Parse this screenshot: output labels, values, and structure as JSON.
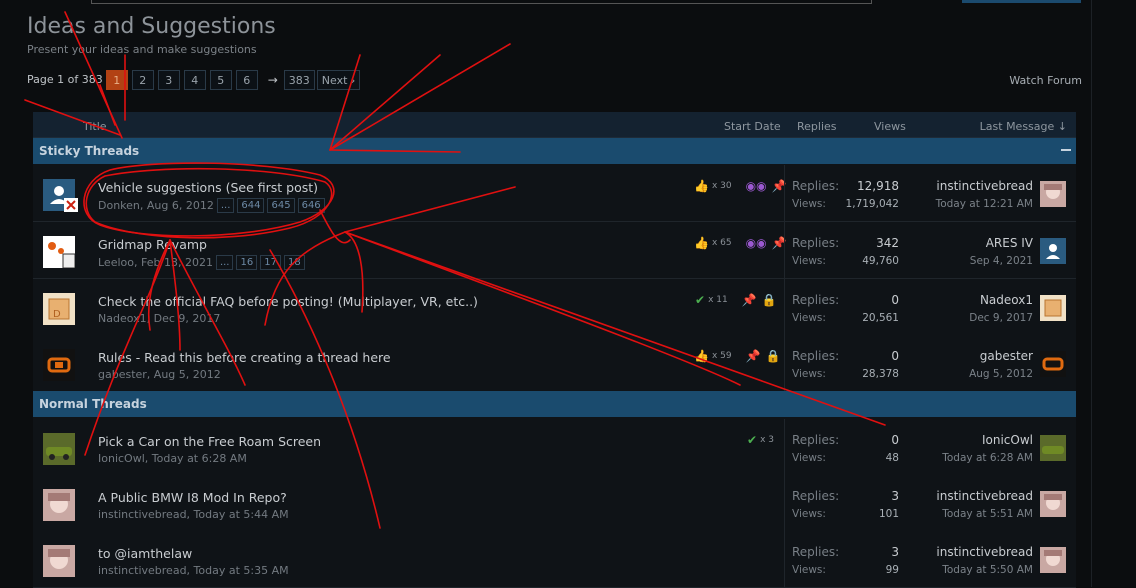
{
  "header": {
    "title": "Ideas and Suggestions",
    "subtitle": "Present your ideas and make suggestions"
  },
  "pagenav": {
    "info": "Page 1 of 383",
    "pages": [
      "1",
      "2",
      "3",
      "4",
      "5",
      "6"
    ],
    "current": "1",
    "arrow": "→",
    "last": "383",
    "next": "Next ›"
  },
  "watch_forum": "Watch Forum",
  "columns": {
    "title": "Title",
    "start_date": "Start Date",
    "replies": "Replies",
    "views": "Views",
    "last_message": "Last Message ↓"
  },
  "sections": {
    "sticky": "Sticky Threads",
    "normal": "Normal Threads"
  },
  "labels": {
    "replies": "Replies:",
    "views": "Views:"
  },
  "threads": [
    {
      "title": "Vehicle suggestions (See first post)",
      "author": "Donken, Aug 6, 2012",
      "pages": [
        "...",
        "644",
        "645",
        "646"
      ],
      "likes": "x 30",
      "replies": "12,918",
      "views": "1,719,042",
      "last_user": "instinctivebread",
      "last_date": "Today at 12:21 AM"
    },
    {
      "title": "Gridmap Revamp",
      "author": "Leeloo, Feb 13, 2021",
      "pages": [
        "...",
        "16",
        "17",
        "18"
      ],
      "likes": "x 65",
      "replies": "342",
      "views": "49,760",
      "last_user": "ARES IV",
      "last_date": "Sep 4, 2021"
    },
    {
      "title": "Check the official FAQ before posting! (Multiplayer, VR, etc..)",
      "author": "Nadeox1, Dec 9, 2017",
      "likes": "x 11",
      "replies": "0",
      "views": "20,561",
      "last_user": "Nadeox1",
      "last_date": "Dec 9, 2017"
    },
    {
      "title": "Rules - Read this before creating a thread here",
      "author": "gabester, Aug 5, 2012",
      "likes": "x 59",
      "replies": "0",
      "views": "28,378",
      "last_user": "gabester",
      "last_date": "Aug 5, 2012"
    },
    {
      "title": "Pick a Car on the Free Roam Screen",
      "author": "IonicOwl, Today at 6:28 AM",
      "likes": "x 3",
      "replies": "0",
      "views": "48",
      "last_user": "IonicOwl",
      "last_date": "Today at 6:28 AM"
    },
    {
      "title": "A Public BMW I8 Mod In Repo?",
      "author": "instinctivebread, Today at 5:44 AM",
      "replies": "3",
      "views": "101",
      "last_user": "instinctivebread",
      "last_date": "Today at 5:51 AM"
    },
    {
      "title": "to @iamthelaw",
      "author": "instinctivebread, Today at 5:35 AM",
      "replies": "3",
      "views": "99",
      "last_user": "instinctivebread",
      "last_date": "Today at 5:50 AM"
    }
  ],
  "colors": {
    "background": "#0b0d0f",
    "section_header": "#1a4b6e",
    "current_page": "#b24214",
    "annotation": "#e01010"
  }
}
